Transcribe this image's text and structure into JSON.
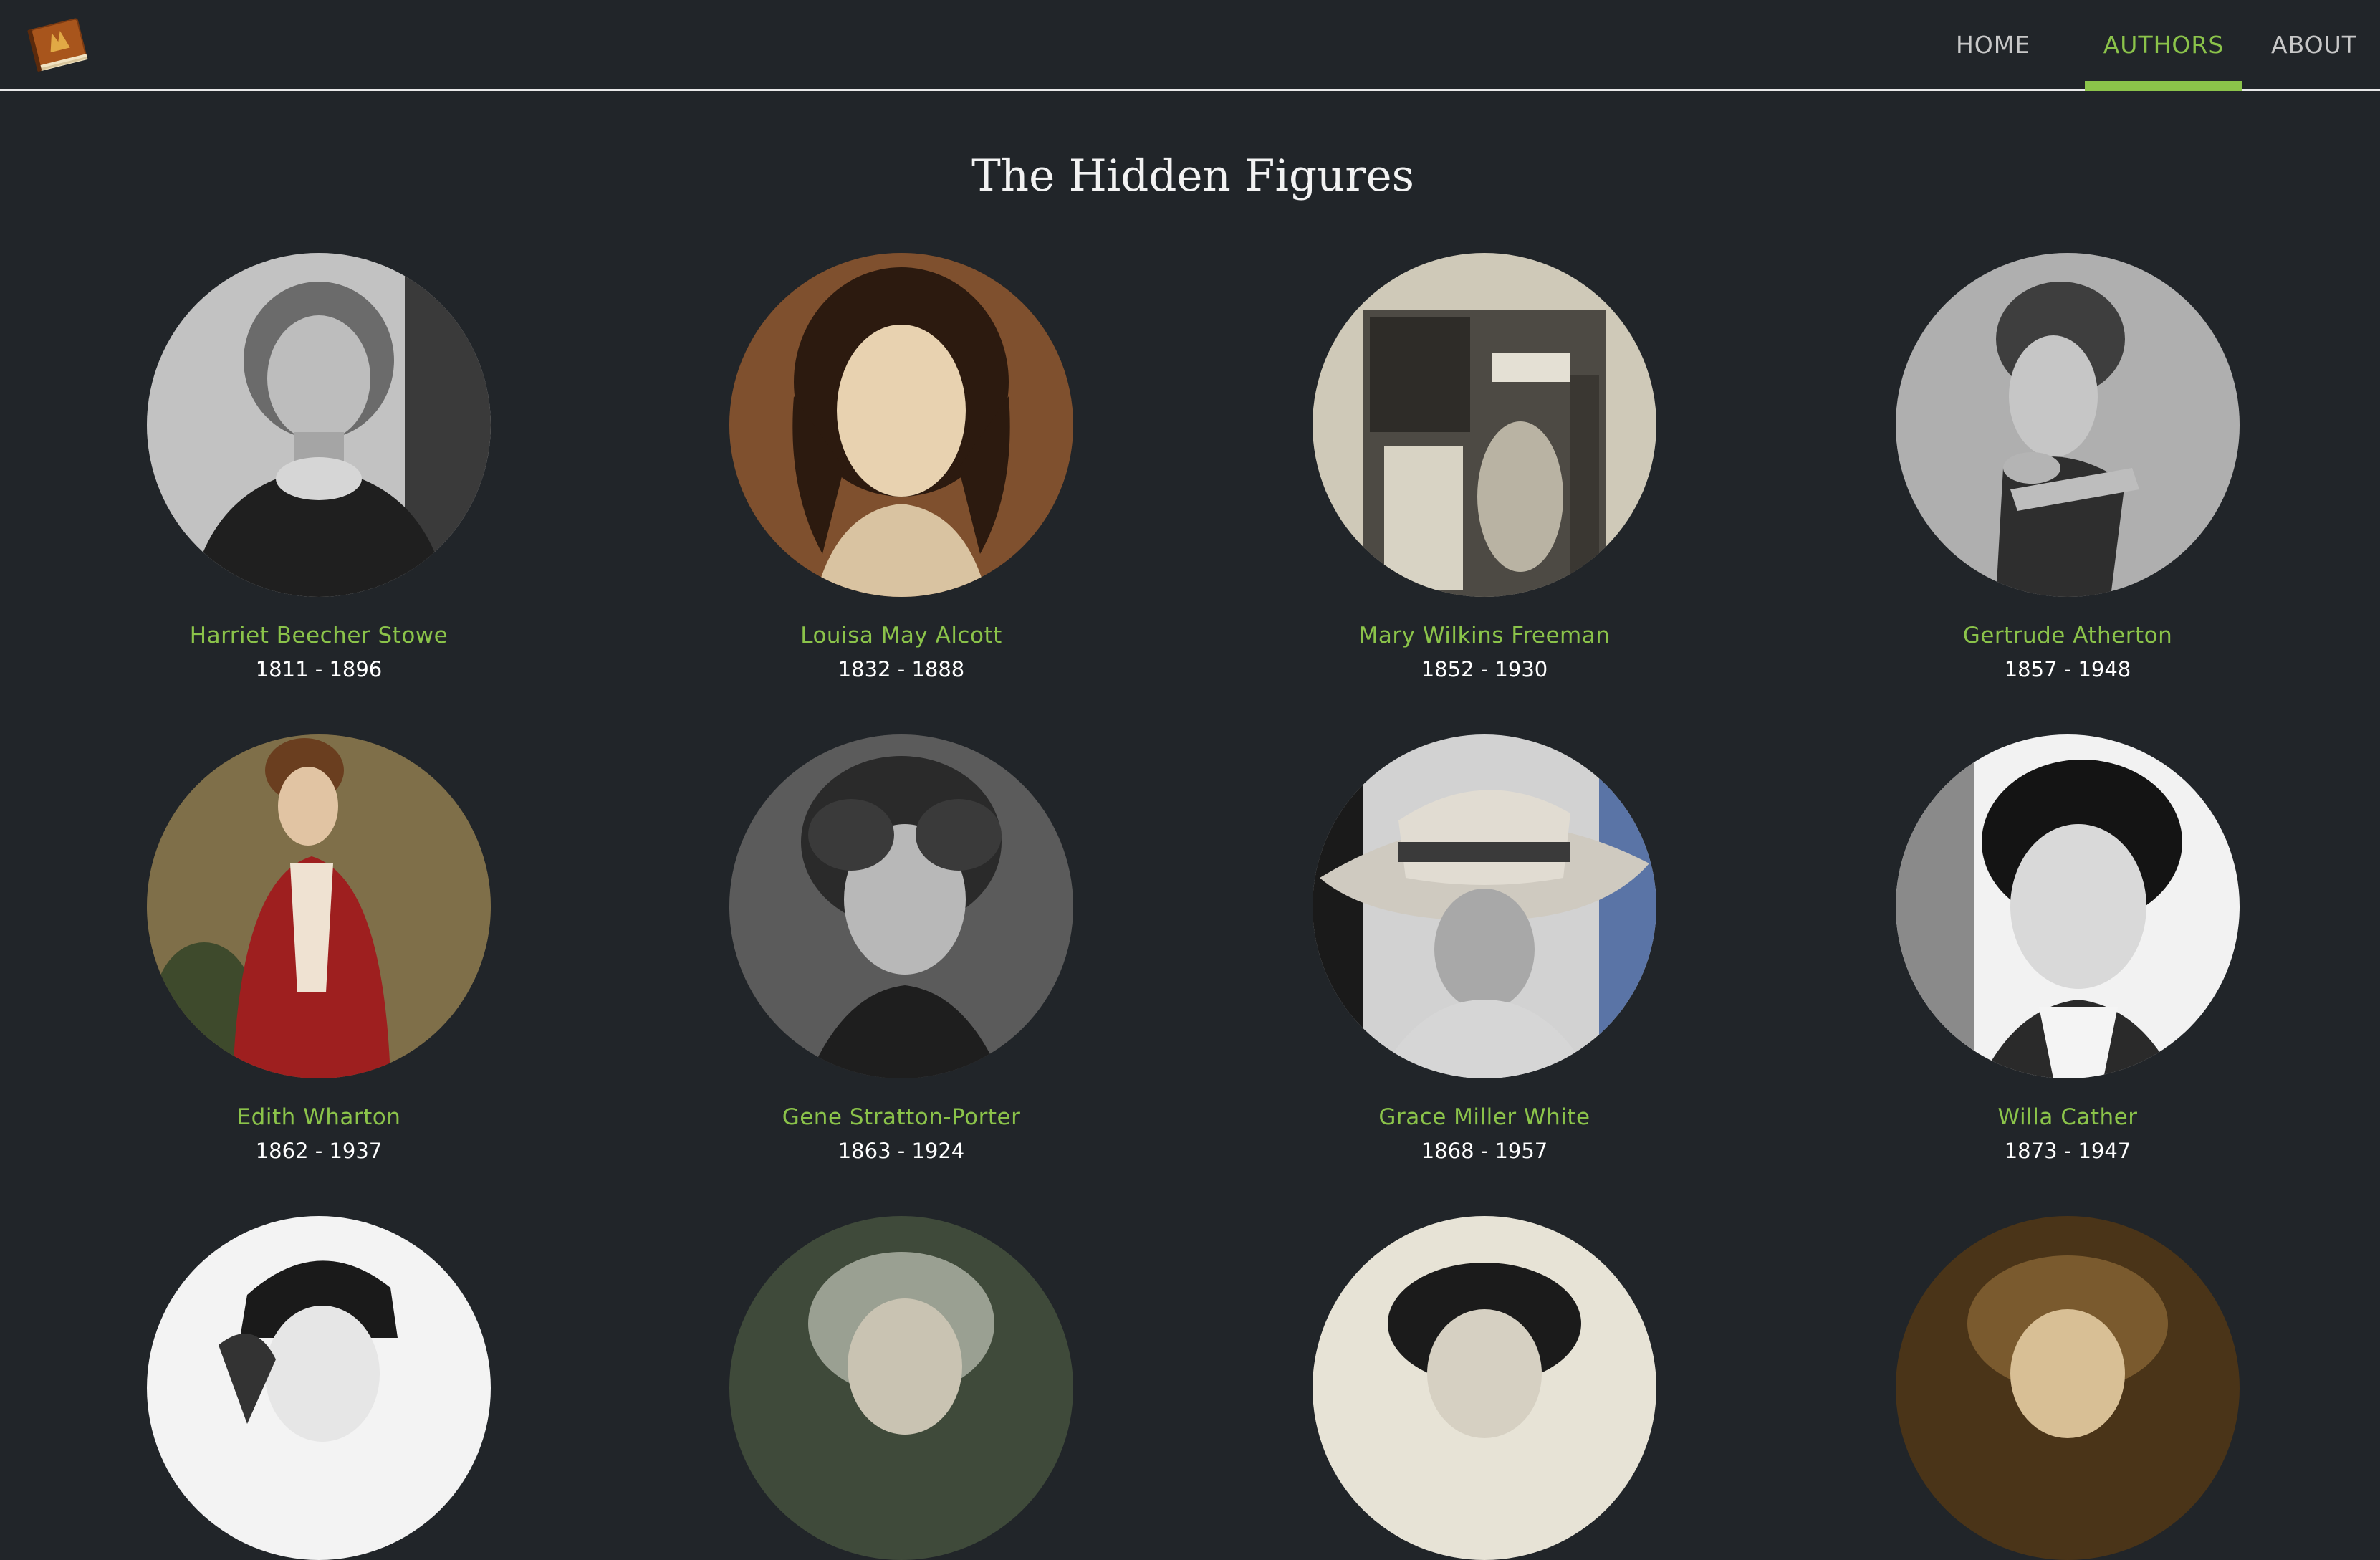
{
  "nav": {
    "logo_icon": "book-logo-icon",
    "items": [
      {
        "label": "HOME",
        "active": false
      },
      {
        "label": "AUTHORS",
        "active": true
      },
      {
        "label": "ABOUT",
        "active": false
      }
    ],
    "accent_color": "#8bc34a"
  },
  "page": {
    "title": "The Hidden Figures",
    "background": "#212529"
  },
  "authors": [
    {
      "name": "Harriet Beecher Stowe",
      "years": "1811 - 1896"
    },
    {
      "name": "Louisa May Alcott",
      "years": "1832 - 1888"
    },
    {
      "name": "Mary Wilkins Freeman",
      "years": "1852 - 1930"
    },
    {
      "name": "Gertrude Atherton",
      "years": "1857 - 1948"
    },
    {
      "name": "Edith Wharton",
      "years": "1862 - 1937"
    },
    {
      "name": "Gene Stratton-Porter",
      "years": "1863 - 1924"
    },
    {
      "name": "Grace Miller White",
      "years": "1868 - 1957"
    },
    {
      "name": "Willa Cather",
      "years": "1873 - 1947"
    }
  ]
}
